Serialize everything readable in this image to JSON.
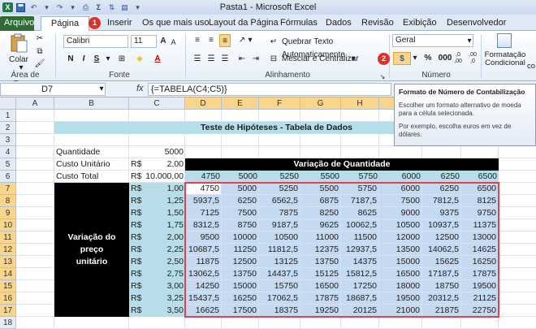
{
  "window": {
    "title": "Pasta1 - Microsoft Excel"
  },
  "qat": {
    "icons": [
      "excel-logo-icon",
      "save-icon",
      "undo-icon",
      "redo-icon",
      "print-preview-icon",
      "sum-icon",
      "sort-icon",
      "print-icon",
      "customize-qat-icon"
    ]
  },
  "tabs": [
    {
      "label": "Arquivo"
    },
    {
      "label": "Página Inicial"
    },
    {
      "label": "Inserir"
    },
    {
      "label": "Os que mais uso"
    },
    {
      "label": "Layout da Página"
    },
    {
      "label": "Fórmulas"
    },
    {
      "label": "Dados"
    },
    {
      "label": "Revisão"
    },
    {
      "label": "Exibição"
    },
    {
      "label": "Desenvolvedor"
    }
  ],
  "badges": {
    "one": "1",
    "two": "2"
  },
  "ribbon": {
    "clipboard": {
      "paste_label": "Colar",
      "group_label": "Área de Tran..."
    },
    "font": {
      "name": "Calibri",
      "size": "11",
      "bold": "N",
      "italic": "I",
      "underline": "S",
      "grow": "A",
      "shrink": "A",
      "color_letter": "A",
      "group_label": "Fonte"
    },
    "alignment": {
      "wrap_label": "Quebrar Texto Automaticamente",
      "merge_label": "Mesclar e Centralizar",
      "group_label": "Alinhamento"
    },
    "number": {
      "format": "Geral",
      "percent": "%",
      "thousands": "000",
      "inc_dec": ",0 ,00",
      "dec_dec": ",00 ,0",
      "group_label": "Número",
      "currency_symbol": "$"
    },
    "styles": {
      "cond_format_label": "Formatação Condicional",
      "more": "co"
    }
  },
  "formula_bar": {
    "name_box": "D7",
    "fx": "fx",
    "formula": "{=TABELA(C4;C5)}"
  },
  "tooltip": {
    "title": "Formato de Número de Contabilização",
    "text1": "Escolher um formato alternativo de moeda para a célula selecionada.",
    "text2": "Por exemplo, escolha euros em vez de dólares."
  },
  "columns": [
    "A",
    "B",
    "C",
    "D",
    "E",
    "F",
    "G",
    "H",
    "I",
    "J",
    "K"
  ],
  "rows": [
    "1",
    "2",
    "3",
    "4",
    "5",
    "6",
    "7",
    "8",
    "9",
    "10",
    "11",
    "12",
    "13",
    "14",
    "15",
    "16",
    "17",
    "18"
  ],
  "sheet": {
    "title": "Teste de Hipóteses - Tabela de Dados",
    "quantidade_label": "Quantidade",
    "quantidade_value": "5000",
    "custo_unit_label": "Custo Unitário",
    "custo_unit_currency": "R$",
    "custo_unit_value": "2,00",
    "custo_total_label": "Custo Total",
    "custo_total_currency": "R$",
    "custo_total_value": "10.000,00",
    "variacao_qtd": "Variação de Quantidade",
    "variacao_preco_1": "Variação do preço",
    "variacao_preco_2": "unitário",
    "quantities": [
      "4750",
      "5000",
      "5250",
      "5500",
      "5750",
      "6000",
      "6250",
      "6500"
    ],
    "price_currency": "R$",
    "prices": [
      "1,00",
      "1,25",
      "1,50",
      "1,75",
      "2,00",
      "2,25",
      "2,50",
      "2,75",
      "3,00",
      "3,25",
      "3,50"
    ],
    "table": [
      [
        "4750",
        "5000",
        "5250",
        "5500",
        "5750",
        "6000",
        "6250",
        "6500"
      ],
      [
        "5937,5",
        "6250",
        "6562,5",
        "6875",
        "7187,5",
        "7500",
        "7812,5",
        "8125"
      ],
      [
        "7125",
        "7500",
        "7875",
        "8250",
        "8625",
        "9000",
        "9375",
        "9750"
      ],
      [
        "8312,5",
        "8750",
        "9187,5",
        "9625",
        "10062,5",
        "10500",
        "10937,5",
        "11375"
      ],
      [
        "9500",
        "10000",
        "10500",
        "11000",
        "11500",
        "12000",
        "12500",
        "13000"
      ],
      [
        "10687,5",
        "11250",
        "11812,5",
        "12375",
        "12937,5",
        "13500",
        "14062,5",
        "14625"
      ],
      [
        "11875",
        "12500",
        "13125",
        "13750",
        "14375",
        "15000",
        "15625",
        "16250"
      ],
      [
        "13062,5",
        "13750",
        "14437,5",
        "15125",
        "15812,5",
        "16500",
        "17187,5",
        "17875"
      ],
      [
        "14250",
        "15000",
        "15750",
        "16500",
        "17250",
        "18000",
        "18750",
        "19500"
      ],
      [
        "15437,5",
        "16250",
        "17062,5",
        "17875",
        "18687,5",
        "19500",
        "20312,5",
        "21125"
      ],
      [
        "16625",
        "17500",
        "18375",
        "19250",
        "20125",
        "21000",
        "21875",
        "22750"
      ]
    ]
  },
  "colors": {
    "header_band": "#b7dde8",
    "black": "#000000",
    "table_bg": "#c5d9f1",
    "highlight": "#e8404a"
  }
}
